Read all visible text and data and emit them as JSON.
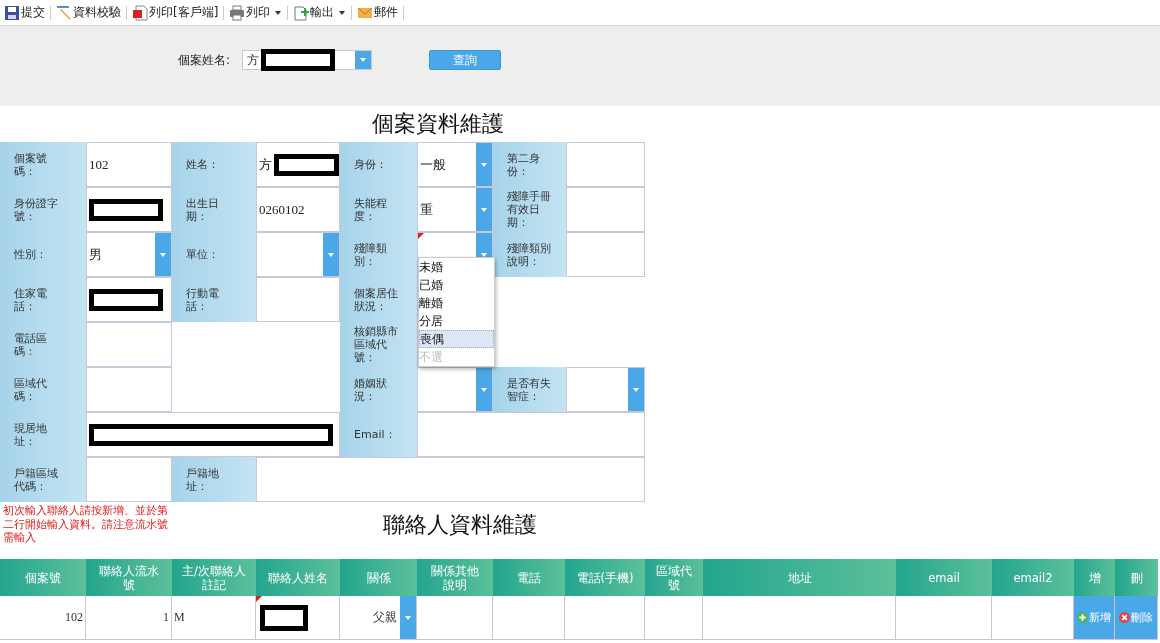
{
  "toolbar": [
    {
      "kind": "save",
      "label": "提交",
      "caret": false
    },
    {
      "kind": "pencil",
      "label": "資料校驗",
      "caret": false
    },
    {
      "kind": "pdf",
      "label": "列印[客戶端]",
      "caret": false
    },
    {
      "kind": "printer",
      "label": "列印",
      "caret": true
    },
    {
      "kind": "export",
      "label": "輸出",
      "caret": true
    },
    {
      "kind": "mail",
      "label": "郵件",
      "caret": false
    }
  ],
  "search": {
    "label": "個案姓名:",
    "value": "方",
    "redacted": true,
    "button": "查詢"
  },
  "form_title": "個案資料維護",
  "form_rows": [
    [
      {
        "label": "個案號碼：",
        "value": "102",
        "kind": "text"
      },
      {
        "label": "姓名：",
        "value": "方",
        "kind": "text",
        "redacted": true
      },
      {
        "label": "身份：",
        "value": "一般",
        "kind": "select"
      },
      {
        "label": "第二身份：",
        "kind": "text"
      }
    ],
    [
      {
        "label": "身份證字號：",
        "kind": "text",
        "redacted": true
      },
      {
        "label": "出生日期：",
        "value": "0260102",
        "kind": "text"
      },
      {
        "label": "失能程度：",
        "value": "重",
        "kind": "select"
      },
      {
        "label": "殘障手冊有效日期：",
        "kind": "text"
      }
    ],
    [
      {
        "label": "性別：",
        "value": "男",
        "kind": "select"
      },
      {
        "label": "單位：",
        "kind": "select"
      },
      {
        "label": "殘障類別：",
        "kind": "select",
        "flagged": true,
        "dropdown": [
          {
            "label": "未婚",
            "selected": false,
            "disabled": false
          },
          {
            "label": "已婚",
            "selected": false,
            "disabled": false
          },
          {
            "label": "離婚",
            "selected": false,
            "disabled": false
          },
          {
            "label": "分居",
            "selected": false,
            "disabled": false
          },
          {
            "label": "喪偶",
            "selected": true,
            "disabled": false
          },
          {
            "label": "不選",
            "selected": false,
            "disabled": true
          }
        ]
      },
      {
        "label": "殘障類別說明：",
        "kind": "text"
      }
    ],
    [
      {
        "label": "住家電話：",
        "kind": "text",
        "redacted": true
      },
      {
        "label": "行動電話：",
        "kind": "text"
      },
      {
        "label": "個案居住狀況：",
        "kind": "text"
      },
      null
    ],
    [
      {
        "label": "電話區碼：",
        "kind": "text"
      },
      null,
      {
        "label": "核銷縣市區域代號：",
        "kind": "text"
      },
      null
    ],
    [
      {
        "label": "區域代碼：",
        "kind": "text"
      },
      null,
      {
        "label": "婚姻狀況：",
        "kind": "select"
      },
      {
        "label": "是否有失智症：",
        "kind": "select"
      }
    ],
    [
      {
        "label": "現居地址：",
        "kind": "wide",
        "redacted": true
      },
      {
        "label": "Email：",
        "kind": "wide"
      }
    ],
    [
      {
        "label": "戶籍區域代碼：",
        "kind": "text"
      },
      {
        "label": "戶籍地址：",
        "kind": "wide"
      }
    ]
  ],
  "note": "初次輸入聯絡人請按新增、並於第二行開始輸入資料。請注意流水號需輸入",
  "contact_title": "聯絡人資料維護",
  "contact_columns": [
    "個案號",
    "聯絡人流水號",
    "主/次聯絡人註記",
    "聯絡人姓名",
    "關係",
    "關係其他說明",
    "電話",
    "電話(手機)",
    "區域代號",
    "地址",
    "email",
    "email2",
    "增",
    "刪"
  ],
  "contact_rows": [
    [
      {
        "kind": "number",
        "value": "102"
      },
      {
        "kind": "number",
        "value": "1"
      },
      {
        "kind": "text",
        "value": "M"
      },
      {
        "kind": "redacted",
        "flagged": true
      },
      {
        "kind": "select",
        "value": "父親"
      },
      {
        "kind": "blank"
      },
      {
        "kind": "blank"
      },
      {
        "kind": "blank"
      },
      {
        "kind": "blank"
      },
      {
        "kind": "blank"
      },
      {
        "kind": "blank"
      },
      {
        "kind": "blank"
      },
      {
        "kind": "add_button",
        "value": "新增"
      },
      {
        "kind": "delete_button",
        "value": "刪除"
      }
    ]
  ]
}
